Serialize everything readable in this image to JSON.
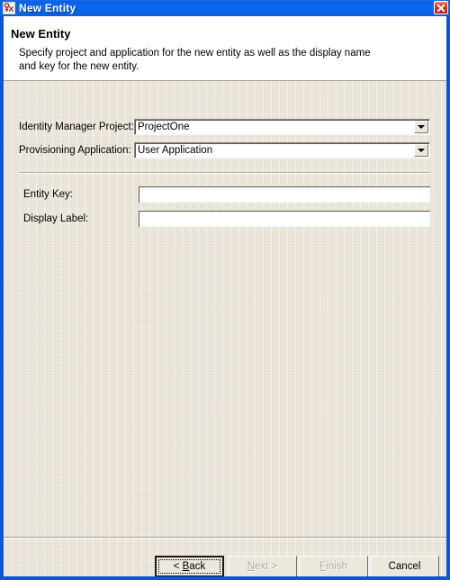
{
  "window": {
    "title": "New Entity",
    "icon": "entity-icon",
    "close_label": "Close"
  },
  "header": {
    "title": "New Entity",
    "description": "Specify project and application for the new entity as well as the display name and key for the new entity."
  },
  "form": {
    "fields": [
      {
        "name": "identity-manager-project",
        "label": "Identity Manager Project:",
        "type": "combobox",
        "value": "ProjectOne"
      },
      {
        "name": "provisioning-application",
        "label": "Provisioning Application:",
        "type": "combobox",
        "value": "User Application"
      },
      {
        "name": "entity-key",
        "label": "Entity Key:",
        "type": "text",
        "value": "",
        "placeholder": ""
      },
      {
        "name": "display-label",
        "label": "Display Label:",
        "type": "text",
        "value": "",
        "placeholder": ""
      }
    ]
  },
  "buttons": {
    "back": {
      "label": "< Back",
      "mnemonic": "B",
      "enabled": true,
      "default": true
    },
    "next": {
      "label": "Next >",
      "mnemonic": "N",
      "enabled": false,
      "default": false
    },
    "finish": {
      "label": "Finish",
      "mnemonic": "F",
      "enabled": false,
      "default": false
    },
    "cancel": {
      "label": "Cancel",
      "mnemonic": "",
      "enabled": true,
      "default": false
    }
  },
  "colors": {
    "titlebar": "#0a68ef",
    "body": "#ece7dc",
    "header": "#ffffff",
    "close_button": "#cf2410",
    "disabled_text": "#adaa9e"
  }
}
